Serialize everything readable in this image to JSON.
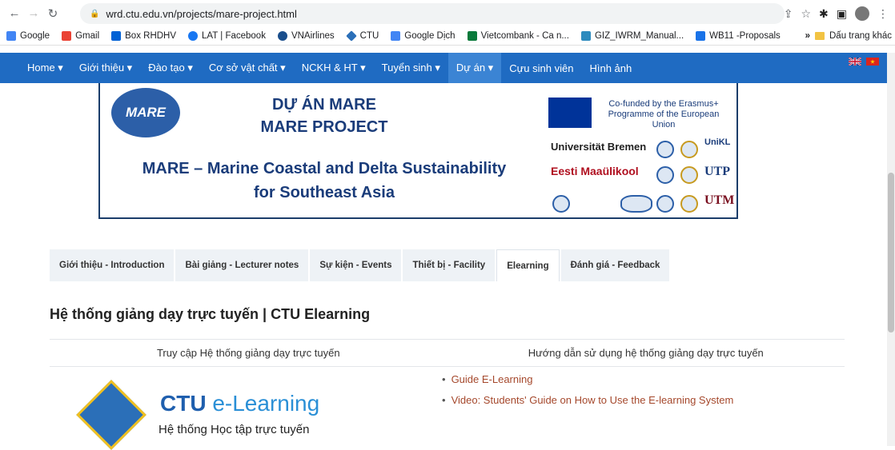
{
  "browser": {
    "url": "wrd.ctu.edu.vn/projects/mare-project.html",
    "bookmarks": [
      "Google",
      "Gmail",
      "Box RHDHV",
      "LAT | Facebook",
      "VNAirlines",
      "CTU",
      "Google Dịch",
      "Vietcombank - Ca n...",
      "GIZ_IWRM_Manual...",
      "WB11 -Proposals"
    ],
    "bookmark_overflow": "»",
    "other_bookmarks": "Dấu trang khác"
  },
  "nav": {
    "items": [
      "Home ▾",
      "Giới thiệu ▾",
      "Đào tạo ▾",
      "Cơ sở vật chất ▾",
      "NCKH & HT ▾",
      "Tuyển sinh ▾",
      "Dự án ▾",
      "Cựu sinh viên",
      "Hình ảnh"
    ],
    "active_index": 6
  },
  "banner": {
    "logo": "MARE",
    "title1": "DỰ ÁN MARE",
    "title2": "MARE PROJECT",
    "subtitle1": "MARE – Marine Coastal and Delta Sustainability",
    "subtitle2": "for Southeast Asia",
    "eu_text": "Co-funded by the Erasmus+ Programme of the European Union",
    "partner1": "Universität Bremen",
    "partner2": "Eesti Maaülikool",
    "partner3": "UTP",
    "partner4": "UTM",
    "partner5": "UniKL"
  },
  "tabs": [
    "Giới thiệu - Introduction",
    "Bài giảng - Lecturer notes",
    "Sự kiện - Events",
    "Thiết bị - Facility",
    "Elearning",
    "Đánh giá - Feedback"
  ],
  "active_tab": 4,
  "section": {
    "title": "Hệ thống giảng dạy trực tuyến | CTU Elearning",
    "col1": "Truy cập Hệ thống giảng dạy trực tuyến",
    "col2": "Hướng dẫn sử dụng hệ thống giảng dạy trực tuyến",
    "links": [
      "Guide E-Learning",
      "Video: Students' Guide on How to Use the E-learning System"
    ]
  },
  "ctu": {
    "brand": "CTU",
    "product": "e-Learning",
    "tagline": "Hệ thống Học tập trực tuyến"
  }
}
